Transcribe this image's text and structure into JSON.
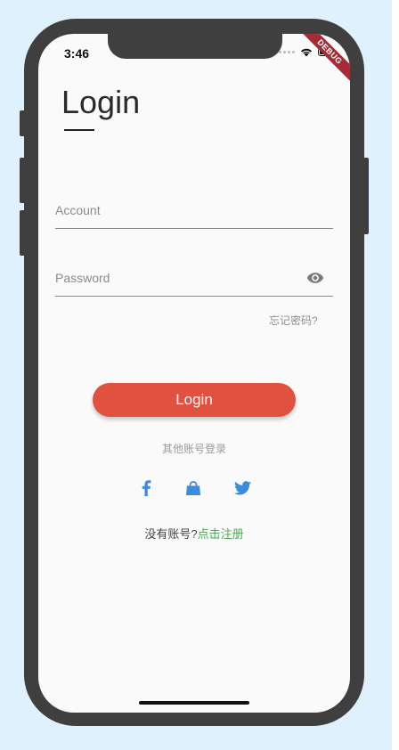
{
  "status_bar": {
    "time": "3:46"
  },
  "debug_banner": "DEBUG",
  "page": {
    "title": "Login"
  },
  "form": {
    "account_placeholder": "Account",
    "password_placeholder": "Password",
    "forgot_password": "忘记密码?"
  },
  "actions": {
    "login_label": "Login"
  },
  "social": {
    "caption": "其他账号登录",
    "providers": [
      "facebook-icon",
      "shopping-bag-icon",
      "twitter-icon"
    ],
    "icon_color": "#3d8bdb"
  },
  "register": {
    "prompt": "没有账号?",
    "link": "点击注册"
  },
  "colors": {
    "accent": "#e0513f",
    "link": "#4aa64f",
    "backdrop": "#dff1fc",
    "frame": "#3f3f3f"
  }
}
